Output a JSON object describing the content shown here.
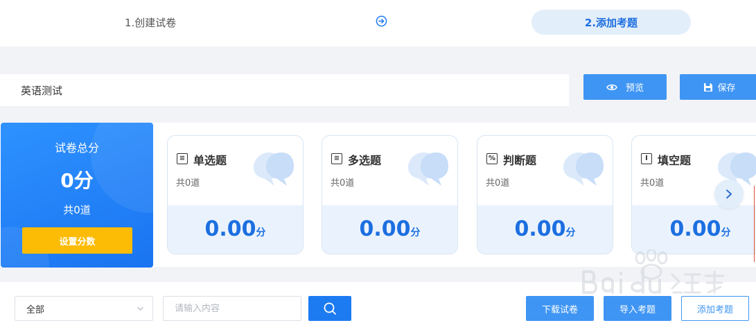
{
  "steps": {
    "step1_label": "1.创建试卷",
    "step2_label": "2.添加考题"
  },
  "exam": {
    "title_value": "英语测试",
    "preview_label": "预览",
    "save_label": "保存"
  },
  "total": {
    "label": "试卷总分",
    "score": "0分",
    "count": "共0道",
    "set_button_label": "设置分数"
  },
  "question_types": [
    {
      "name": "单选题",
      "count": "共0道",
      "score": "0.00",
      "unit": "分",
      "icon": "list-icon"
    },
    {
      "name": "多选题",
      "count": "共0道",
      "score": "0.00",
      "unit": "分",
      "icon": "list-icon"
    },
    {
      "name": "判断题",
      "count": "共0道",
      "score": "0.00",
      "unit": "分",
      "icon": "percent-icon"
    },
    {
      "name": "填空题",
      "count": "共0道",
      "score": "0.00",
      "unit": "分",
      "icon": "text-cursor-icon"
    }
  ],
  "filter": {
    "selected_option": "全部",
    "search_placeholder": "请输入内容"
  },
  "actions": {
    "download_label": "下载试卷",
    "import_label": "导入考题",
    "add_label": "添加考题"
  },
  "colors": {
    "primary": "#3f95f3",
    "accent_text": "#1d6fe0",
    "warning": "#fcbb04"
  }
}
